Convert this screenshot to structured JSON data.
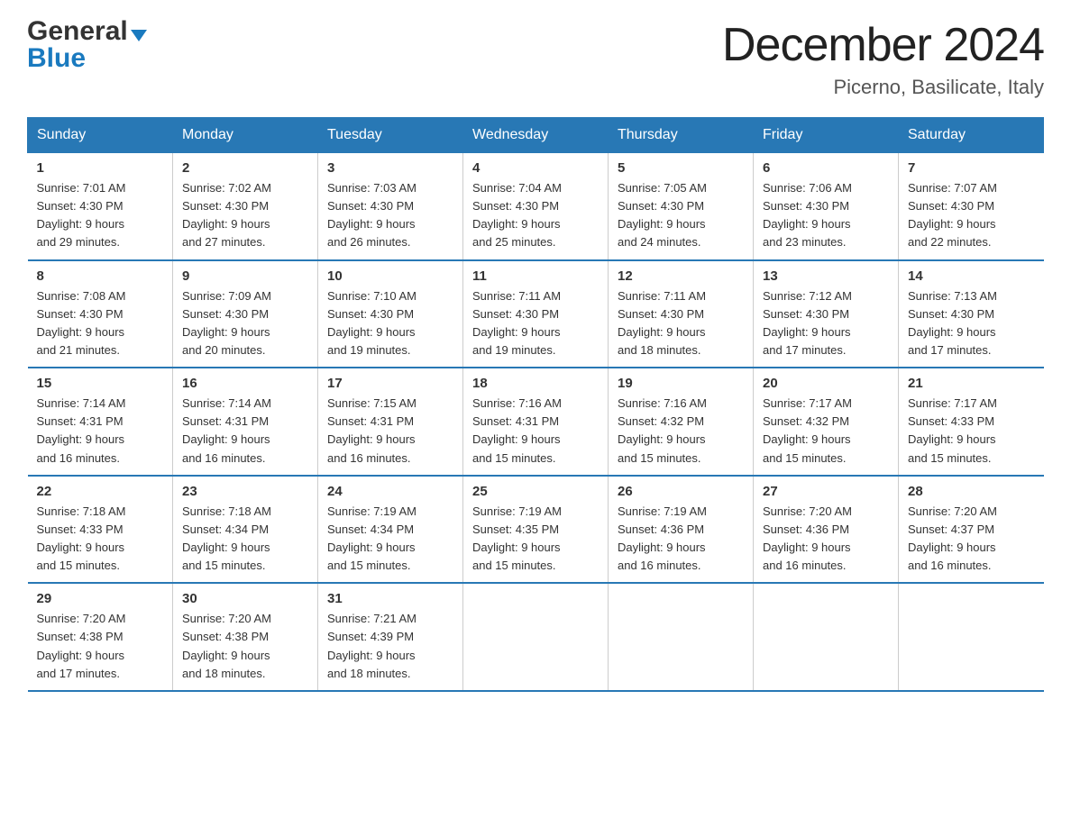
{
  "logo": {
    "general": "General",
    "blue": "Blue",
    "triangle": "▲"
  },
  "title": {
    "month_year": "December 2024",
    "location": "Picerno, Basilicate, Italy"
  },
  "days_of_week": [
    "Sunday",
    "Monday",
    "Tuesday",
    "Wednesday",
    "Thursday",
    "Friday",
    "Saturday"
  ],
  "weeks": [
    [
      {
        "day": "1",
        "sunrise": "7:01 AM",
        "sunset": "4:30 PM",
        "daylight": "9 hours and 29 minutes."
      },
      {
        "day": "2",
        "sunrise": "7:02 AM",
        "sunset": "4:30 PM",
        "daylight": "9 hours and 27 minutes."
      },
      {
        "day": "3",
        "sunrise": "7:03 AM",
        "sunset": "4:30 PM",
        "daylight": "9 hours and 26 minutes."
      },
      {
        "day": "4",
        "sunrise": "7:04 AM",
        "sunset": "4:30 PM",
        "daylight": "9 hours and 25 minutes."
      },
      {
        "day": "5",
        "sunrise": "7:05 AM",
        "sunset": "4:30 PM",
        "daylight": "9 hours and 24 minutes."
      },
      {
        "day": "6",
        "sunrise": "7:06 AM",
        "sunset": "4:30 PM",
        "daylight": "9 hours and 23 minutes."
      },
      {
        "day": "7",
        "sunrise": "7:07 AM",
        "sunset": "4:30 PM",
        "daylight": "9 hours and 22 minutes."
      }
    ],
    [
      {
        "day": "8",
        "sunrise": "7:08 AM",
        "sunset": "4:30 PM",
        "daylight": "9 hours and 21 minutes."
      },
      {
        "day": "9",
        "sunrise": "7:09 AM",
        "sunset": "4:30 PM",
        "daylight": "9 hours and 20 minutes."
      },
      {
        "day": "10",
        "sunrise": "7:10 AM",
        "sunset": "4:30 PM",
        "daylight": "9 hours and 19 minutes."
      },
      {
        "day": "11",
        "sunrise": "7:11 AM",
        "sunset": "4:30 PM",
        "daylight": "9 hours and 19 minutes."
      },
      {
        "day": "12",
        "sunrise": "7:11 AM",
        "sunset": "4:30 PM",
        "daylight": "9 hours and 18 minutes."
      },
      {
        "day": "13",
        "sunrise": "7:12 AM",
        "sunset": "4:30 PM",
        "daylight": "9 hours and 17 minutes."
      },
      {
        "day": "14",
        "sunrise": "7:13 AM",
        "sunset": "4:30 PM",
        "daylight": "9 hours and 17 minutes."
      }
    ],
    [
      {
        "day": "15",
        "sunrise": "7:14 AM",
        "sunset": "4:31 PM",
        "daylight": "9 hours and 16 minutes."
      },
      {
        "day": "16",
        "sunrise": "7:14 AM",
        "sunset": "4:31 PM",
        "daylight": "9 hours and 16 minutes."
      },
      {
        "day": "17",
        "sunrise": "7:15 AM",
        "sunset": "4:31 PM",
        "daylight": "9 hours and 16 minutes."
      },
      {
        "day": "18",
        "sunrise": "7:16 AM",
        "sunset": "4:31 PM",
        "daylight": "9 hours and 15 minutes."
      },
      {
        "day": "19",
        "sunrise": "7:16 AM",
        "sunset": "4:32 PM",
        "daylight": "9 hours and 15 minutes."
      },
      {
        "day": "20",
        "sunrise": "7:17 AM",
        "sunset": "4:32 PM",
        "daylight": "9 hours and 15 minutes."
      },
      {
        "day": "21",
        "sunrise": "7:17 AM",
        "sunset": "4:33 PM",
        "daylight": "9 hours and 15 minutes."
      }
    ],
    [
      {
        "day": "22",
        "sunrise": "7:18 AM",
        "sunset": "4:33 PM",
        "daylight": "9 hours and 15 minutes."
      },
      {
        "day": "23",
        "sunrise": "7:18 AM",
        "sunset": "4:34 PM",
        "daylight": "9 hours and 15 minutes."
      },
      {
        "day": "24",
        "sunrise": "7:19 AM",
        "sunset": "4:34 PM",
        "daylight": "9 hours and 15 minutes."
      },
      {
        "day": "25",
        "sunrise": "7:19 AM",
        "sunset": "4:35 PM",
        "daylight": "9 hours and 15 minutes."
      },
      {
        "day": "26",
        "sunrise": "7:19 AM",
        "sunset": "4:36 PM",
        "daylight": "9 hours and 16 minutes."
      },
      {
        "day": "27",
        "sunrise": "7:20 AM",
        "sunset": "4:36 PM",
        "daylight": "9 hours and 16 minutes."
      },
      {
        "day": "28",
        "sunrise": "7:20 AM",
        "sunset": "4:37 PM",
        "daylight": "9 hours and 16 minutes."
      }
    ],
    [
      {
        "day": "29",
        "sunrise": "7:20 AM",
        "sunset": "4:38 PM",
        "daylight": "9 hours and 17 minutes."
      },
      {
        "day": "30",
        "sunrise": "7:20 AM",
        "sunset": "4:38 PM",
        "daylight": "9 hours and 18 minutes."
      },
      {
        "day": "31",
        "sunrise": "7:21 AM",
        "sunset": "4:39 PM",
        "daylight": "9 hours and 18 minutes."
      },
      null,
      null,
      null,
      null
    ]
  ],
  "labels": {
    "sunrise": "Sunrise: ",
    "sunset": "Sunset: ",
    "daylight": "Daylight: "
  }
}
